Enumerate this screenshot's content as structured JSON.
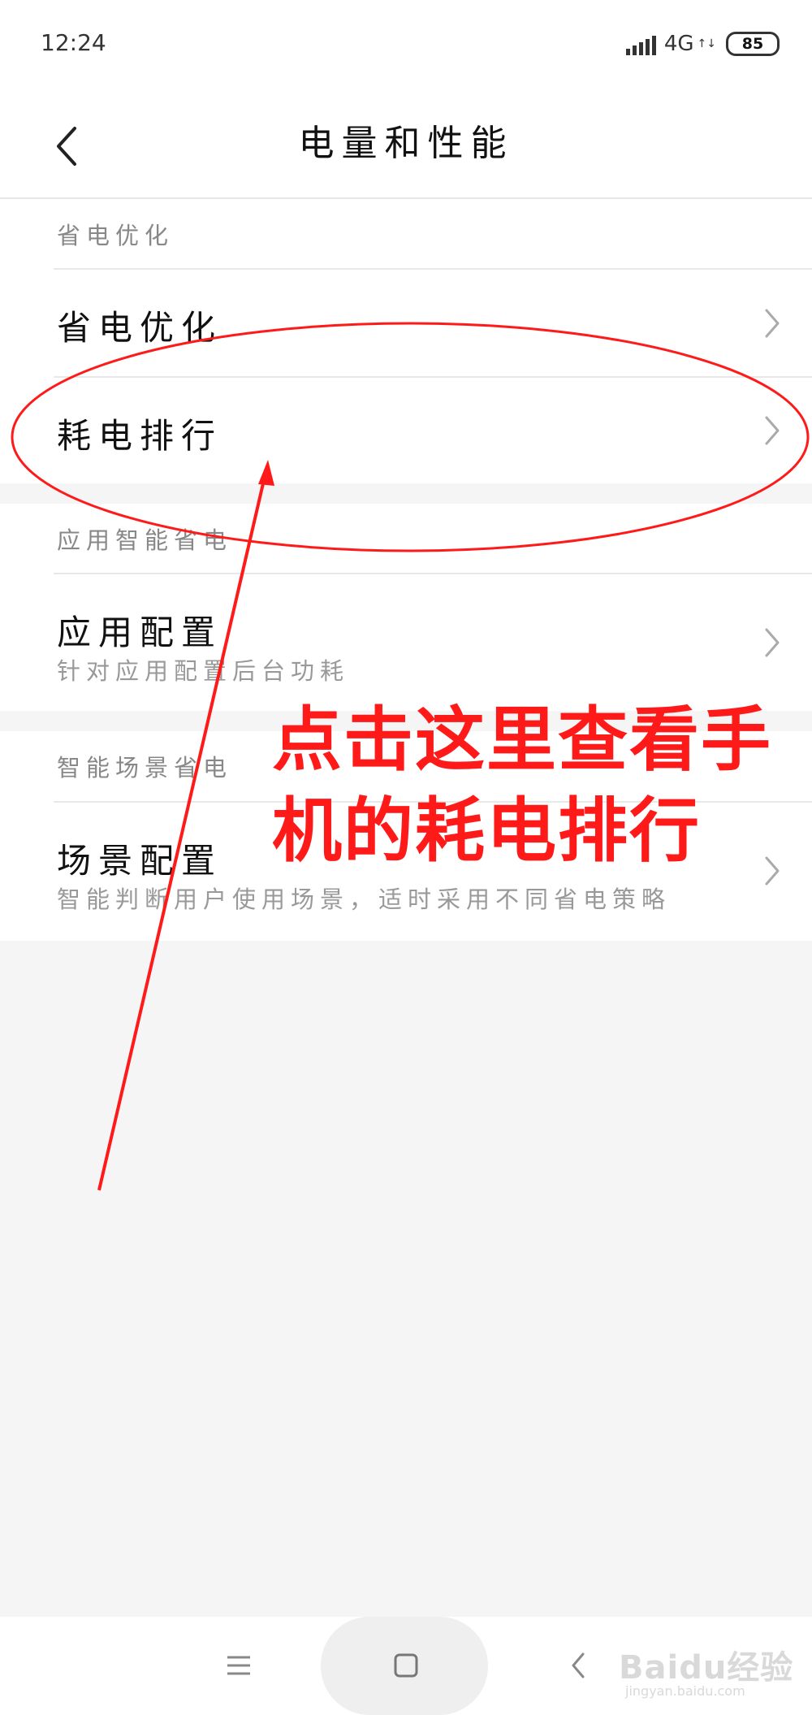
{
  "status_bar": {
    "time": "12:24",
    "network_type": "4G",
    "battery": "85"
  },
  "header": {
    "title": "电量和性能",
    "back_icon": "chevron-left-icon"
  },
  "sections": [
    {
      "header": "省电优化",
      "rows": [
        {
          "title": "省电优化",
          "subtitle": ""
        },
        {
          "title": "耗电排行",
          "subtitle": ""
        }
      ]
    },
    {
      "header": "应用智能省电",
      "rows": [
        {
          "title": "应用配置",
          "subtitle": "针对应用配置后台功耗"
        }
      ]
    },
    {
      "header": "智能场景省电",
      "rows": [
        {
          "title": "场景配置",
          "subtitle": "智能判断用户使用场景，适时采用不同省电策略"
        }
      ]
    }
  ],
  "nav_bar": {
    "menu_icon": "menu-icon",
    "home_icon": "home-square-icon",
    "back_icon": "back-chevron-icon"
  },
  "annotation": {
    "text_line1": "点击这里查看手",
    "text_line2": "机的耗电排行",
    "color": "#ff1a1a"
  },
  "watermark": {
    "text": "Baidu经验",
    "sub": "jingyan.baidu.com"
  },
  "colors": {
    "background": "#f5f5f5",
    "surface": "#ffffff",
    "annotation_red": "#ff1a1a"
  }
}
